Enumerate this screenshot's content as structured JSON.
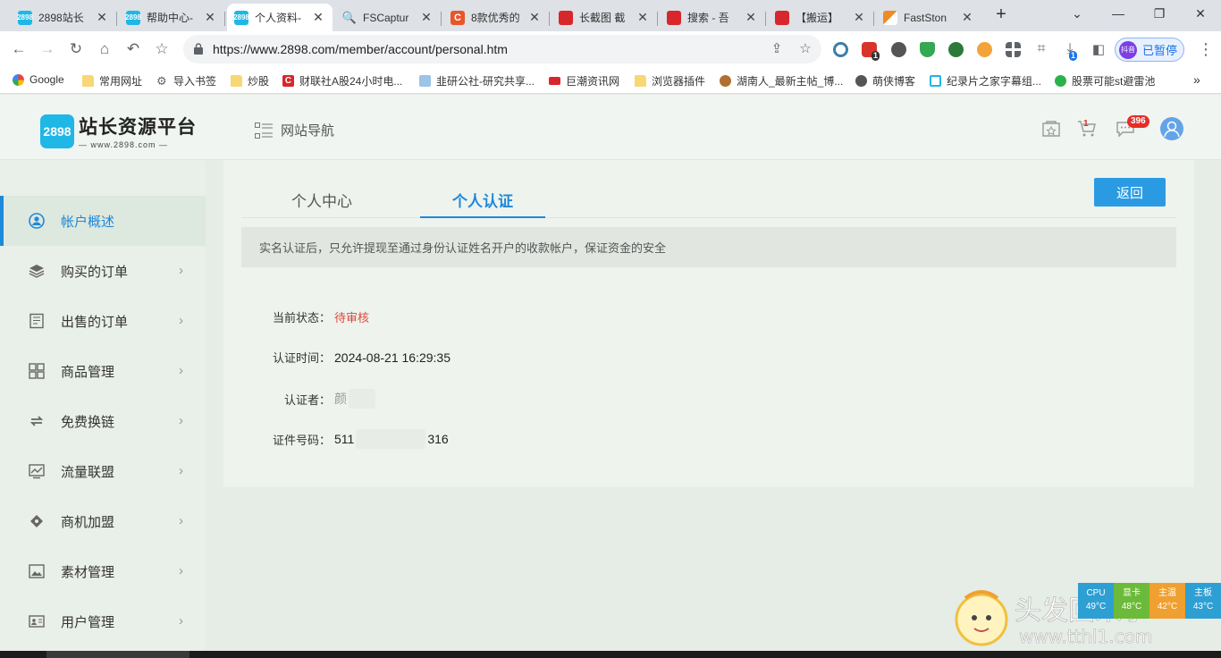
{
  "browser": {
    "tabs": [
      {
        "title": "2898站长",
        "favicon_color": "#1eb7e6",
        "favicon_text": "2898"
      },
      {
        "title": "帮助中心-",
        "favicon_color": "#1eb7e6",
        "favicon_text": "2898"
      },
      {
        "title": "个人资料-",
        "favicon_color": "#1eb7e6",
        "favicon_text": "2898"
      },
      {
        "title": "FSCaptur",
        "favicon_color": "#ffffff",
        "favicon_text": ""
      },
      {
        "title": "8款优秀的",
        "favicon_color": "#e8552b",
        "favicon_text": "C"
      },
      {
        "title": "长截图 截",
        "favicon_color": "#d7262c",
        "favicon_text": ""
      },
      {
        "title": "搜索 - 吾",
        "favicon_color": "#d7262c",
        "favicon_text": ""
      },
      {
        "title": "【搬运】",
        "favicon_color": "#d7262c",
        "favicon_text": ""
      },
      {
        "title": "FastSton",
        "favicon_color": "#f08a24",
        "favicon_text": ""
      }
    ],
    "url": "https://www.2898.com/member/account/personal.htm",
    "profile_label": "已暂停",
    "profile_avatar_text": "抖音",
    "bookmarks": [
      "Google",
      "常用网址",
      "导入书签",
      "炒股",
      "财联社A股24小时电...",
      "韭研公社-研究共享...",
      "巨潮资讯网",
      "浏览器插件",
      "湖南人_最新主帖_博...",
      "萌侠博客",
      "纪录片之家字幕组...",
      "股票可能st避雷池"
    ],
    "download_badge": "1",
    "ext_badge": "1"
  },
  "site": {
    "logo_mark": "2898",
    "logo_title": "站长资源平台",
    "logo_sub": "— www.2898.com —",
    "nav_label": "网站导航",
    "cart_badge": "1",
    "msg_badge": "396"
  },
  "sidebar": {
    "items": [
      {
        "label": "帐户概述",
        "active": true
      },
      {
        "label": "购买的订单"
      },
      {
        "label": "出售的订单"
      },
      {
        "label": "商品管理"
      },
      {
        "label": "免费换链"
      },
      {
        "label": "流量联盟"
      },
      {
        "label": "商机加盟"
      },
      {
        "label": "素材管理"
      },
      {
        "label": "用户管理"
      }
    ]
  },
  "main": {
    "tabs": [
      "个人中心",
      "个人认证"
    ],
    "back_label": "返回",
    "notice": "实名认证后，只允许提现至通过身份认证姓名开户的收款帐户，保证资金的安全",
    "fields": {
      "status_label": "当前状态：",
      "status_value": "待审核",
      "time_label": "认证时间：",
      "time_value": "2024-08-21 16:29:35",
      "person_label": "认证者：",
      "person_value": "颜",
      "id_label": "证件号码：",
      "id_prefix": "511",
      "id_suffix": "316"
    }
  },
  "overlay": {
    "hw_monitor": [
      {
        "name": "CPU",
        "value": "49°C",
        "color": "#2e9fd3"
      },
      {
        "name": "显卡",
        "value": "48°C",
        "color": "#6cba3a"
      },
      {
        "name": "主温",
        "value": "42°C",
        "color": "#f0a030"
      },
      {
        "name": "主板",
        "value": "43°C",
        "color": "#2e9fd3"
      }
    ],
    "watermark": "头发回来了 www.tthl1.com"
  }
}
